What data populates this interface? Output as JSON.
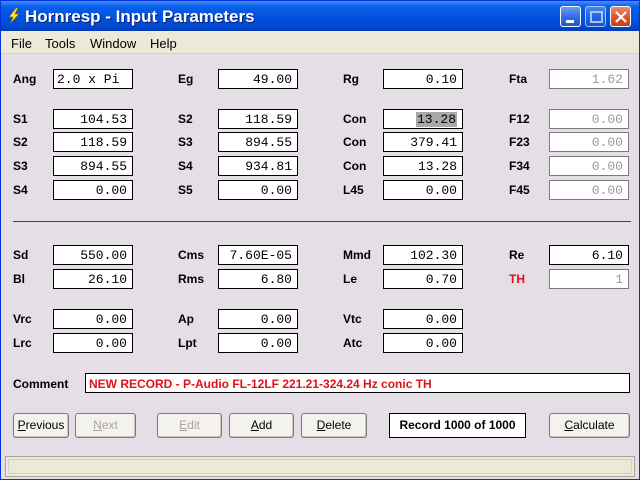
{
  "window": {
    "title": "Hornresp - Input Parameters"
  },
  "menu": [
    "File",
    "Tools",
    "Window",
    "Help"
  ],
  "params": {
    "Ang": "2.0 x Pi",
    "Eg": "49.00",
    "Rg": "0.10",
    "Fta": "1.62",
    "S1": "104.53",
    "S2a": "118.59",
    "Con1": "13.28",
    "F12": "0.00",
    "S2b": "118.59",
    "S3a": "894.55",
    "Con2": "379.41",
    "F23": "0.00",
    "S3b": "894.55",
    "S4a": "934.81",
    "Con3": "13.28",
    "F34": "0.00",
    "S4b": "0.00",
    "S5": "0.00",
    "L45": "0.00",
    "F45": "0.00",
    "Sd": "550.00",
    "Cms": "7.60E-05",
    "Mmd": "102.30",
    "Re": "6.10",
    "Bl": "26.10",
    "Rms": "6.80",
    "Le": "0.70",
    "TH": "1",
    "Vrc": "0.00",
    "Ap": "0.00",
    "Vtc": "0.00",
    "Lrc": "0.00",
    "Lpt": "0.00",
    "Atc": "0.00"
  },
  "labels": {
    "Ang": "Ang",
    "Eg": "Eg",
    "Rg": "Rg",
    "Fta": "Fta",
    "S1": "S1",
    "S2": "S2",
    "S3": "S3",
    "S4": "S4",
    "S5": "S5",
    "Con": "Con",
    "L45": "L45",
    "F12": "F12",
    "F23": "F23",
    "F34": "F34",
    "F45": "F45",
    "Sd": "Sd",
    "Cms": "Cms",
    "Mmd": "Mmd",
    "Re": "Re",
    "Bl": "Bl",
    "Rms": "Rms",
    "Le": "Le",
    "TH": "TH",
    "Vrc": "Vrc",
    "Ap": "Ap",
    "Vtc": "Vtc",
    "Lrc": "Lrc",
    "Lpt": "Lpt",
    "Atc": "Atc",
    "Comment": "Comment"
  },
  "comment": "NEW RECORD - P-Audio FL-12LF 221.21-324.24 Hz conic TH",
  "buttons": {
    "previous": {
      "pre": "",
      "ul": "P",
      "post": "revious"
    },
    "next": {
      "pre": "",
      "ul": "N",
      "post": "ext"
    },
    "edit": {
      "pre": "",
      "ul": "E",
      "post": "dit"
    },
    "add": {
      "pre": "",
      "ul": "A",
      "post": "dd"
    },
    "delete": {
      "pre": "",
      "ul": "D",
      "post": "elete"
    },
    "calculate": {
      "pre": "",
      "ul": "C",
      "post": "alculate"
    }
  },
  "record": "Record 1000 of 1000",
  "colors": {
    "title_bar": "#0054e3",
    "window_bg": "#e6dee6",
    "comment_text": "#e0101a",
    "th_label": "#e0101a"
  }
}
